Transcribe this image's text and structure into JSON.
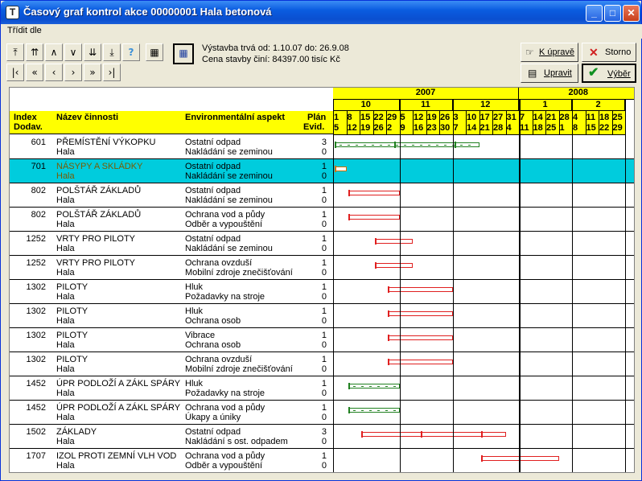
{
  "window": {
    "title": "Časový graf kontrol akce 00000001 Hala betonová",
    "icon_letter": "T"
  },
  "menu": {
    "sort": "Třídit dle"
  },
  "info": {
    "line1": "Výstavba trvá  od: 1.10.07 do: 26.9.08",
    "line2": "Cena stavby činí: 84397.00 tisíc Kč"
  },
  "buttons": {
    "edit_label": "K úpravě",
    "storno_label": "Storno",
    "modify_label": "Upravit",
    "select_label": "Výběr"
  },
  "columns": {
    "index": "Index",
    "index2": "Dodav.",
    "name": "Název  činnosti",
    "env": "Environmentální aspekt",
    "plan": "Plán",
    "evid": "Evid."
  },
  "timeline": {
    "years": [
      {
        "label": "2007",
        "weeks": 14
      },
      {
        "label": "2008",
        "weeks": 9
      }
    ],
    "months": [
      {
        "label": "10",
        "weeks": 5
      },
      {
        "label": "11",
        "weeks": 4
      },
      {
        "label": "12",
        "weeks": 5
      },
      {
        "label": "1",
        "weeks": 4
      },
      {
        "label": "2",
        "weeks": 4
      }
    ],
    "week_top": [
      "1",
      "8",
      "15",
      "22",
      "29",
      "5",
      "12",
      "19",
      "26",
      "3",
      "10",
      "17",
      "27",
      "31",
      "7",
      "14",
      "21",
      "28",
      "4",
      "11",
      "18",
      "25"
    ],
    "week_bottom": [
      "5",
      "12",
      "19",
      "26",
      "2",
      "9",
      "16",
      "23",
      "30",
      "7",
      "14",
      "21",
      "28",
      "4",
      "11",
      "18",
      "25",
      "1",
      "8",
      "15",
      "22",
      "29"
    ]
  },
  "rows": [
    {
      "index": "601",
      "name": "PŘEMÍSTĚNÍ VÝKOPKU",
      "sub": "Hala",
      "env1": "Ostatní odpad",
      "env2": "Nakládání se zeminou",
      "plan": "3",
      "evid": "0",
      "color": "green",
      "start": 0,
      "end": 11,
      "ticks": [
        0,
        4.5,
        9
      ],
      "dashed": true
    },
    {
      "index": "701",
      "name": "NÁSYPY A SKLÁDKY",
      "sub": "Hala",
      "env1": "Ostatní odpad",
      "env2": "Nakládání se zeminou",
      "plan": "1",
      "evid": "0",
      "color": "orange",
      "start": 0,
      "end": 1,
      "ticks": [
        0
      ],
      "dashed": false,
      "selected": true
    },
    {
      "index": "802",
      "name": "POLŠTÁŘ ZÁKLADŮ",
      "sub": "Hala",
      "env1": "Ostatní odpad",
      "env2": "Nakládání se zeminou",
      "plan": "1",
      "evid": "0",
      "color": "red",
      "start": 1,
      "end": 5,
      "ticks": [
        1
      ],
      "dashed": false
    },
    {
      "index": "802",
      "name": "POLŠTÁŘ ZÁKLADŮ",
      "sub": "Hala",
      "env1": "Ochrana vod a půdy",
      "env2": "Odběr a vypouštění",
      "plan": "1",
      "evid": "0",
      "color": "red",
      "start": 1,
      "end": 5,
      "ticks": [
        1
      ],
      "dashed": false
    },
    {
      "index": "1252",
      "name": "VRTY PRO PILOTY",
      "sub": "Hala",
      "env1": "Ostatní odpad",
      "env2": "Nakládání se zeminou",
      "plan": "1",
      "evid": "0",
      "color": "red",
      "start": 3,
      "end": 6,
      "ticks": [
        3
      ],
      "dashed": false
    },
    {
      "index": "1252",
      "name": "VRTY PRO PILOTY",
      "sub": "Hala",
      "env1": "Ochrana ovzduší",
      "env2": "Mobilní zdroje znečišťování",
      "plan": "1",
      "evid": "0",
      "color": "red",
      "start": 3,
      "end": 6,
      "ticks": [
        3
      ],
      "dashed": false
    },
    {
      "index": "1302",
      "name": "PILOTY",
      "sub": "Hala",
      "env1": "Hluk",
      "env2": "Požadavky na stroje",
      "plan": "1",
      "evid": "0",
      "color": "red",
      "start": 4,
      "end": 9,
      "ticks": [
        4
      ],
      "dashed": false
    },
    {
      "index": "1302",
      "name": "PILOTY",
      "sub": "Hala",
      "env1": "Hluk",
      "env2": "Ochrana osob",
      "plan": "1",
      "evid": "0",
      "color": "red",
      "start": 4,
      "end": 9,
      "ticks": [
        4
      ],
      "dashed": false
    },
    {
      "index": "1302",
      "name": "PILOTY",
      "sub": "Hala",
      "env1": "Vibrace",
      "env2": "Ochrana osob",
      "plan": "1",
      "evid": "0",
      "color": "red",
      "start": 4,
      "end": 9,
      "ticks": [
        4
      ],
      "dashed": false
    },
    {
      "index": "1302",
      "name": "PILOTY",
      "sub": "Hala",
      "env1": "Ochrana ovzduší",
      "env2": "Mobilní zdroje znečišťování",
      "plan": "1",
      "evid": "0",
      "color": "red",
      "start": 4,
      "end": 9,
      "ticks": [
        4
      ],
      "dashed": false
    },
    {
      "index": "1452",
      "name": "ÚPR PODLOŽÍ A ZÁKL SPÁRY",
      "sub": "Hala",
      "env1": "Hluk",
      "env2": "Požadavky na stroje",
      "plan": "1",
      "evid": "0",
      "color": "green",
      "start": 1,
      "end": 5,
      "ticks": [
        1
      ],
      "dashed": true
    },
    {
      "index": "1452",
      "name": "ÚPR PODLOŽÍ A ZÁKL SPÁRY",
      "sub": "Hala",
      "env1": "Ochrana vod a půdy",
      "env2": "Úkapy a úniky",
      "plan": "1",
      "evid": "0",
      "color": "green",
      "start": 1,
      "end": 5,
      "ticks": [
        1
      ],
      "dashed": true
    },
    {
      "index": "1502",
      "name": "ZÁKLADY",
      "sub": "Hala",
      "env1": "Ostatní odpad",
      "env2": "Nakládání s ost. odpadem",
      "plan": "3",
      "evid": "0",
      "color": "red",
      "start": 2,
      "end": 13,
      "ticks": [
        2,
        6.5,
        11
      ],
      "dashed": false
    },
    {
      "index": "1707",
      "name": "IZOL PROTI ZEMNÍ VLH VOD",
      "sub": "Hala",
      "env1": "Ochrana vod a půdy",
      "env2": "Odběr a vypouštění",
      "plan": "1",
      "evid": "0",
      "color": "red",
      "start": 11,
      "end": 17,
      "ticks": [
        11
      ],
      "dashed": false
    }
  ]
}
